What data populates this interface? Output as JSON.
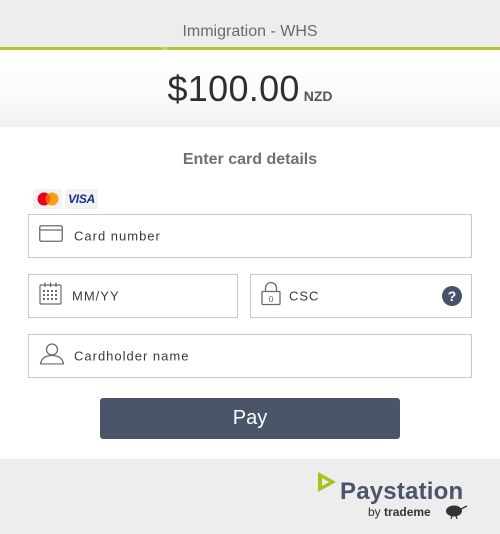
{
  "header": {
    "title": "Immigration - WHS"
  },
  "payment": {
    "amount": "$100.00",
    "currency": "NZD"
  },
  "form": {
    "title": "Enter card details",
    "card_brands": {
      "visa": "VISA"
    },
    "fields": {
      "card_number": "Card number",
      "expiry": "MM/YY",
      "csc": "CSC",
      "csc_help": "?",
      "cardholder": "Cardholder name"
    },
    "pay_label": "Pay"
  },
  "footer": {
    "brand": "Paystation",
    "by": "by",
    "brand_sub": "trademe"
  },
  "colors": {
    "accent": "#b7bf2d",
    "button": "#4a5569",
    "brand_text": "#4a5568",
    "logo_green": "#a8c31f"
  }
}
